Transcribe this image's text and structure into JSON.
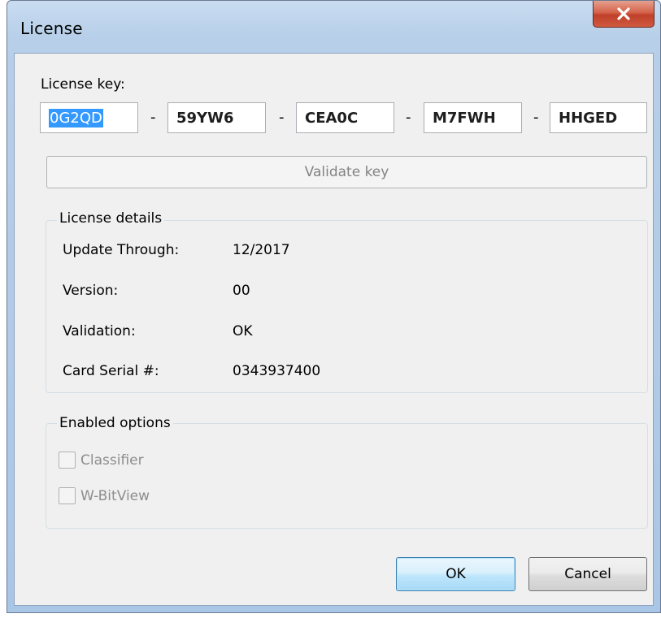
{
  "window": {
    "title": "License",
    "close_icon": "close-icon"
  },
  "license_key": {
    "label": "License key:",
    "segments": [
      "0G2QD",
      "59YW6",
      "CEA0C",
      "M7FWH",
      "HHGED"
    ],
    "separator": "-",
    "validate_label": "Validate key"
  },
  "details": {
    "title": "License details",
    "rows": [
      {
        "label": "Update Through:",
        "value": "12/2017"
      },
      {
        "label": "Version:",
        "value": "00"
      },
      {
        "label": "Validation:",
        "value": "OK"
      },
      {
        "label": "Card Serial #:",
        "value": "0343937400"
      }
    ]
  },
  "options": {
    "title": "Enabled options",
    "items": [
      {
        "label": "Classifier",
        "checked": false,
        "enabled": false
      },
      {
        "label": "W-BitView",
        "checked": false,
        "enabled": false
      }
    ]
  },
  "buttons": {
    "ok_label": "OK",
    "cancel_label": "Cancel"
  },
  "colors": {
    "selection": "#3399ff",
    "close_button": "#c7432b",
    "ok_border": "#3c7fb1"
  }
}
